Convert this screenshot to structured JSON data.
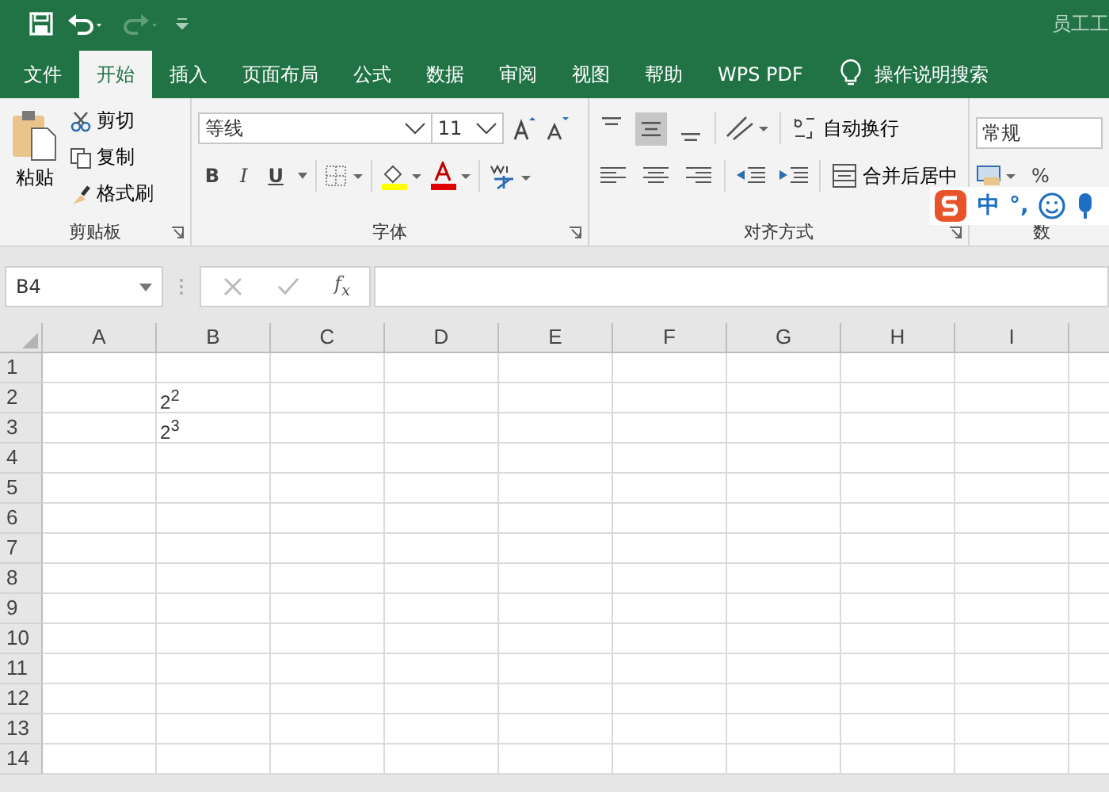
{
  "title_bar": {
    "title": "员工工"
  },
  "tabs": [
    {
      "label": "文件",
      "selected": false
    },
    {
      "label": "开始",
      "selected": true
    },
    {
      "label": "插入",
      "selected": false
    },
    {
      "label": "页面布局",
      "selected": false
    },
    {
      "label": "公式",
      "selected": false
    },
    {
      "label": "数据",
      "selected": false
    },
    {
      "label": "审阅",
      "selected": false
    },
    {
      "label": "视图",
      "selected": false
    },
    {
      "label": "帮助",
      "selected": false
    },
    {
      "label": "WPS PDF",
      "selected": false
    }
  ],
  "tell_me": {
    "label": "操作说明搜索"
  },
  "clipboard": {
    "paste": "粘贴",
    "cut": "剪切",
    "copy": "复制",
    "format_painter": "格式刷",
    "group_label": "剪贴板"
  },
  "font": {
    "font_name": "等线",
    "font_size": "11",
    "bold": "B",
    "italic": "I",
    "underline": "U",
    "group_label": "字体"
  },
  "alignment": {
    "vertical": [
      {
        "selected": false
      },
      {
        "selected": true
      },
      {
        "selected": false
      }
    ],
    "wrap_text": "自动换行",
    "merge_center": "合并后居中",
    "group_label": "对齐方式"
  },
  "number": {
    "format": "常规",
    "percent": "%",
    "group_label": "数"
  },
  "ime_bar": {
    "mode": "中",
    "punctuation": "°,"
  },
  "formula_bar": {
    "name_box": "B4",
    "function_label": "f$_{x}$"
  },
  "columns": [
    "A",
    "B",
    "C",
    "D",
    "E",
    "F",
    "G",
    "H",
    "I"
  ],
  "rows": [
    {
      "label": "1"
    },
    {
      "label": "2",
      "column_b": "2$^{2}$"
    },
    {
      "label": "3",
      "column_b": "2$^{3}$"
    },
    {
      "label": "4"
    },
    {
      "label": "5"
    },
    {
      "label": "6"
    },
    {
      "label": "7"
    },
    {
      "label": "8"
    },
    {
      "label": "9"
    },
    {
      "label": "10"
    },
    {
      "label": "11"
    },
    {
      "label": "12"
    },
    {
      "label": "13"
    },
    {
      "label": "14"
    }
  ]
}
